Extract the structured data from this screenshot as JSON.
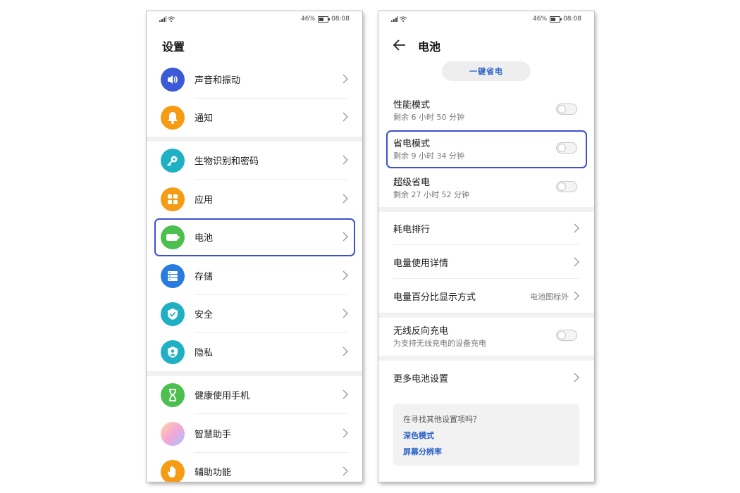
{
  "status_bar": {
    "battery": "46%",
    "time": "08:08"
  },
  "left": {
    "title": "设置",
    "items": [
      {
        "label": "声音和振动",
        "icon": "speaker-icon",
        "color": "#3b5ad6"
      },
      {
        "label": "通知",
        "icon": "bell-icon",
        "color": "#f59b14"
      },
      {
        "label": "生物识别和密码",
        "icon": "key-icon",
        "color": "#1fb0c3"
      },
      {
        "label": "应用",
        "icon": "apps-grid-icon",
        "color": "#f59b14"
      },
      {
        "label": "电池",
        "icon": "battery-icon",
        "color": "#4cbf4e"
      },
      {
        "label": "存储",
        "icon": "storage-icon",
        "color": "#2a7be0"
      },
      {
        "label": "安全",
        "icon": "shield-check-icon",
        "color": "#1fb0c3"
      },
      {
        "label": "隐私",
        "icon": "privacy-icon",
        "color": "#1fb0c3"
      },
      {
        "label": "健康使用手机",
        "icon": "hourglass-icon",
        "color": "#4cbf4e"
      },
      {
        "label": "智慧助手",
        "icon": "assistant-orb-icon",
        "color": "#e8a0d0"
      },
      {
        "label": "辅助功能",
        "icon": "hand-icon",
        "color": "#f59b14"
      }
    ]
  },
  "right": {
    "title": "电池",
    "one_click_save": "一键省电",
    "modes": [
      {
        "title": "性能模式",
        "subtitle": "剩余 6 小时 50 分钟",
        "enabled": false
      },
      {
        "title": "省电模式",
        "subtitle": "剩余 9 小时 34 分钟",
        "enabled": false
      },
      {
        "title": "超级省电",
        "subtitle": "剩余 27 小时 52 分钟",
        "enabled": false
      }
    ],
    "nav": [
      {
        "label": "耗电排行",
        "value": ""
      },
      {
        "label": "电量使用详情",
        "value": ""
      },
      {
        "label": "电量百分比显示方式",
        "value": "电池图标外"
      }
    ],
    "wireless": {
      "title": "无线反向充电",
      "subtitle": "为支持无线充电的设备充电",
      "enabled": false
    },
    "more": "更多电池设置",
    "suggest": {
      "question": "在寻找其他设置项吗？",
      "links": [
        "深色模式",
        "屏幕分辨率"
      ]
    }
  },
  "colors": {
    "highlight": "#3e4fcf",
    "link": "#2b63c9"
  }
}
